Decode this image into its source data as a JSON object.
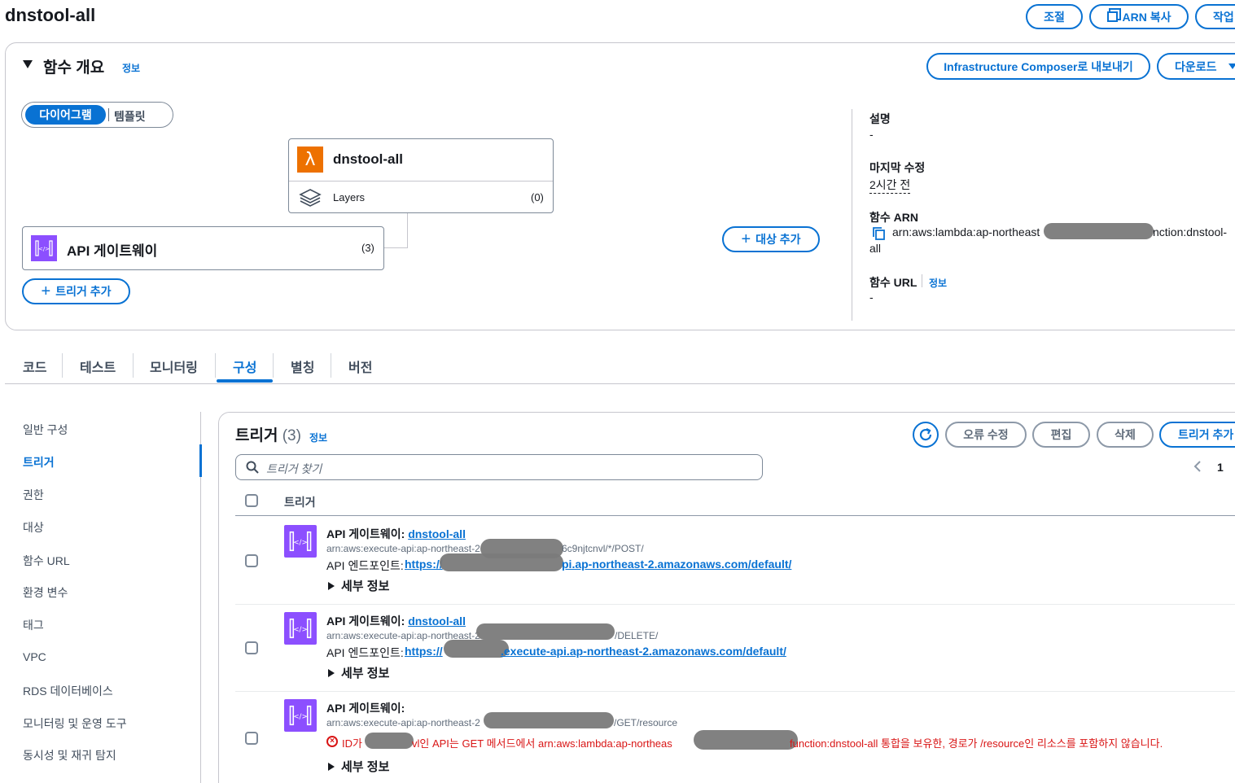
{
  "header": {
    "title": "dnstool-all",
    "buttons": {
      "throttle": "조절",
      "copy_arn": "ARN 복사",
      "actions": "작업"
    }
  },
  "overview": {
    "title": "함수 개요",
    "info": "정보",
    "export_button": "Infrastructure Composer로 내보내기",
    "download_button": "다운로드",
    "toggle": {
      "diagram": "다이어그램",
      "template": "템플릿"
    },
    "function_card": {
      "name": "dnstool-all",
      "layers_label": "Layers",
      "layers_count": "(0)"
    },
    "trigger_card": {
      "name": "API 게이트웨이",
      "count": "(3)"
    },
    "add_trigger": "트리거 추가",
    "add_destination": "대상 추가",
    "details": {
      "description_label": "설명",
      "description_value": "-",
      "last_modified_label": "마지막 수정",
      "last_modified_value": "2시간 전",
      "arn_label": "함수 ARN",
      "arn_prefix": "arn:aws:lambda:ap-northeast",
      "arn_suffix": "nction:dnstool-",
      "arn_tail": "all",
      "url_label": "함수 URL",
      "url_info": "정보",
      "url_value": "-"
    }
  },
  "tabs": [
    "코드",
    "테스트",
    "모니터링",
    "구성",
    "별칭",
    "버전"
  ],
  "active_tab": "구성",
  "sidebar": {
    "items": [
      "일반 구성",
      "트리거",
      "권한",
      "대상",
      "함수 URL",
      "환경 변수",
      "태그",
      "VPC",
      "RDS 데이터베이스",
      "모니터링 및 운영 도구",
      "동시성 및 재귀 탐지"
    ],
    "active": "트리거"
  },
  "triggers": {
    "title": "트리거",
    "count": "(3)",
    "info": "정보",
    "buttons": {
      "fix_errors": "오류 수정",
      "edit": "편집",
      "delete": "삭제",
      "add": "트리거 추가"
    },
    "search_placeholder": "트리거 찾기",
    "page": "1",
    "column": "트리거",
    "rows": [
      {
        "label": "API 게이트웨이:",
        "link": "dnstool-all",
        "arn_start": "arn:aws:execute-api:ap-northeast-2",
        "arn_end": "6c9njtcnvl/*/POST/",
        "endpoint_label": "API 엔드포인트:",
        "endpoint_start": "https://",
        "endpoint_end": "pi.ap-northeast-2.amazonaws.com/default/",
        "details": "세부 정보"
      },
      {
        "label": "API 게이트웨이:",
        "link": "dnstool-all",
        "arn_start": "arn:aws:execute-api:ap-northeast-2",
        "arn_end": "/DELETE/",
        "endpoint_label": "API 엔드포인트:",
        "endpoint_start": "https://",
        "endpoint_end": ".execute-api.ap-northeast-2.amazonaws.com/default/",
        "details": "세부 정보"
      },
      {
        "label": "API 게이트웨이:",
        "arn_start": "arn:aws:execute-api:ap-northeast-2",
        "arn_end": "/GET/resource",
        "error_start": "ID가",
        "error_mid": "vl인 API는 GET 메서드에서 arn:aws:lambda:ap-northeas",
        "error_end": "function:dnstool-all 통합을 보유한, 경로가 /resource인 리소스를 포함하지 않습니다.",
        "details": "세부 정보"
      }
    ]
  },
  "colors": {
    "accent": "#0972d3",
    "lambda": "#ed7100",
    "api": "#8c4fff",
    "error": "#d91515"
  }
}
